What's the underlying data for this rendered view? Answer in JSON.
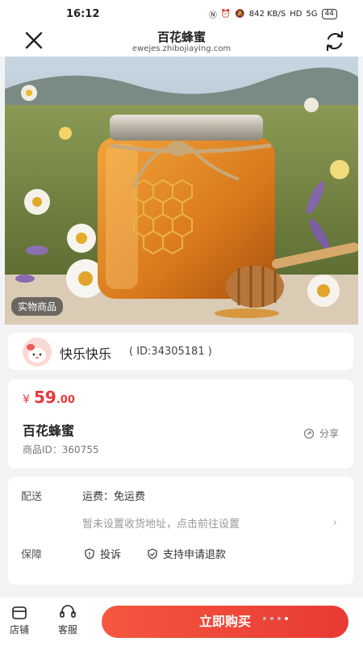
{
  "status": {
    "time": "16:12",
    "network": "842 KB/S",
    "hd": "HD",
    "signal": "5G",
    "battery": "44"
  },
  "nav": {
    "title": "百花蜂蜜",
    "url": "ewejes.zhibojiaying.com"
  },
  "hero": {
    "badge": "实物商品"
  },
  "shop": {
    "name": "快乐快乐",
    "id_text": "( ID:34305181 )"
  },
  "product": {
    "currency": "¥",
    "price_int": "59",
    "price_dec": ".00",
    "name": "百花蜂蜜",
    "id_label": "商品ID：",
    "id_value": "360755",
    "share": "分享"
  },
  "info": {
    "delivery_label": "配送",
    "freight": "运费：免运费",
    "address_hint": "暂未设置收货地址，点击前往设置",
    "arrow": "›",
    "guarantee_label": "保障",
    "complaint": "投诉",
    "refund": "支持申请退款"
  },
  "bottom": {
    "store": "店铺",
    "service": "客服",
    "buy": "立即购买"
  },
  "colors": {
    "accent": "#e93a34",
    "price": "#e4393c"
  },
  "icons": [
    "close-icon",
    "refresh-icon",
    "share-icon",
    "shield-icon",
    "check-badge-icon",
    "store-icon",
    "headset-icon"
  ]
}
